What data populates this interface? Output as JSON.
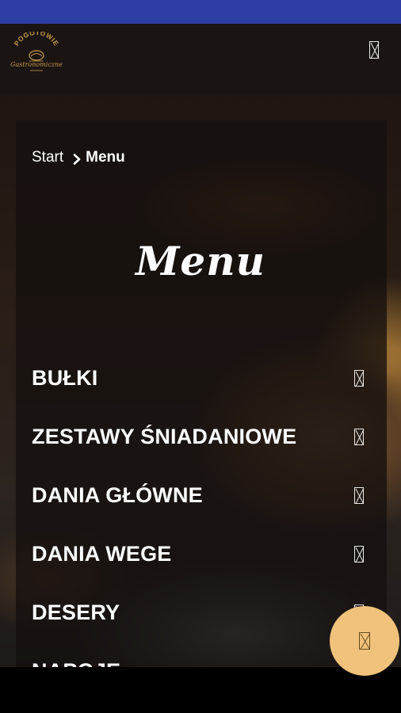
{
  "header": {
    "logo": {
      "text_top": "POGOTOWIE",
      "text_bottom": "Gastronomiczne"
    },
    "menu_icon": "missing-glyph-icon"
  },
  "breadcrumb": {
    "start_label": "Start",
    "separator_icon": "chevron-right-icon",
    "current_label": "Menu"
  },
  "page": {
    "title": "Menu"
  },
  "menu": {
    "items": [
      {
        "label": "BUŁKI",
        "icon": "missing-glyph-icon"
      },
      {
        "label": "ZESTAWY ŚNIADANIOWE",
        "icon": "missing-glyph-icon"
      },
      {
        "label": "DANIA GŁÓWNE",
        "icon": "missing-glyph-icon"
      },
      {
        "label": "DANIA WEGE",
        "icon": "missing-glyph-icon"
      },
      {
        "label": "DESERY",
        "icon": "missing-glyph-icon"
      },
      {
        "label": "NAPOJE",
        "icon": "missing-glyph-icon"
      }
    ]
  },
  "fab": {
    "icon": "missing-glyph-icon",
    "color": "#f0c27b"
  },
  "colors": {
    "status_bar": "#2d3fa6",
    "header_bg": "#1a1412",
    "text": "#ffffff",
    "accent": "#f0c27b"
  }
}
